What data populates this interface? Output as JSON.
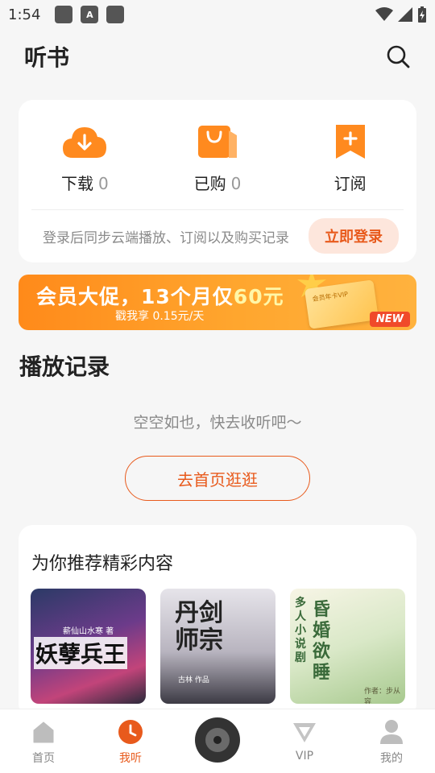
{
  "status": {
    "time": "1:54",
    "notif_icon_letter": "A"
  },
  "header": {
    "title": "听书"
  },
  "quick": {
    "items": [
      {
        "label": "下载",
        "count": "0",
        "icon": "download-cloud-icon"
      },
      {
        "label": "已购",
        "count": "0",
        "icon": "shopping-bag-icon"
      },
      {
        "label": "订阅",
        "count": "",
        "icon": "bookmark-plus-icon"
      }
    ],
    "login_hint": "登录后同步云端播放、订阅以及购买记录",
    "login_button": "立即登录"
  },
  "banner": {
    "headline_a": "会员大促，13个月仅",
    "headline_price": "60元",
    "sub": "戳我享 0.15元/天",
    "card_text": "会员年卡VIP",
    "tag": "NEW"
  },
  "history": {
    "title": "播放记录",
    "empty_text": "空空如也，快去收听吧～",
    "go_button": "去首页逛逛"
  },
  "recommend": {
    "title": "为你推荐精彩内容",
    "books": [
      {
        "cover_title": "妖孽兵王",
        "cover_author": "薪仙山水寒 著"
      },
      {
        "cover_title": "丹剑师宗",
        "cover_author": "古林 作品"
      },
      {
        "cover_title": "昏婚欲睡",
        "cover_subtitle": "多人小说剧",
        "cover_author": "作者：步从容"
      }
    ]
  },
  "nav": {
    "items": [
      {
        "label": "首页"
      },
      {
        "label": "我听"
      },
      {
        "label": "VIP"
      },
      {
        "label": "我的"
      }
    ]
  },
  "colors": {
    "accent": "#e85a1c",
    "banner": "#ff9a24"
  }
}
